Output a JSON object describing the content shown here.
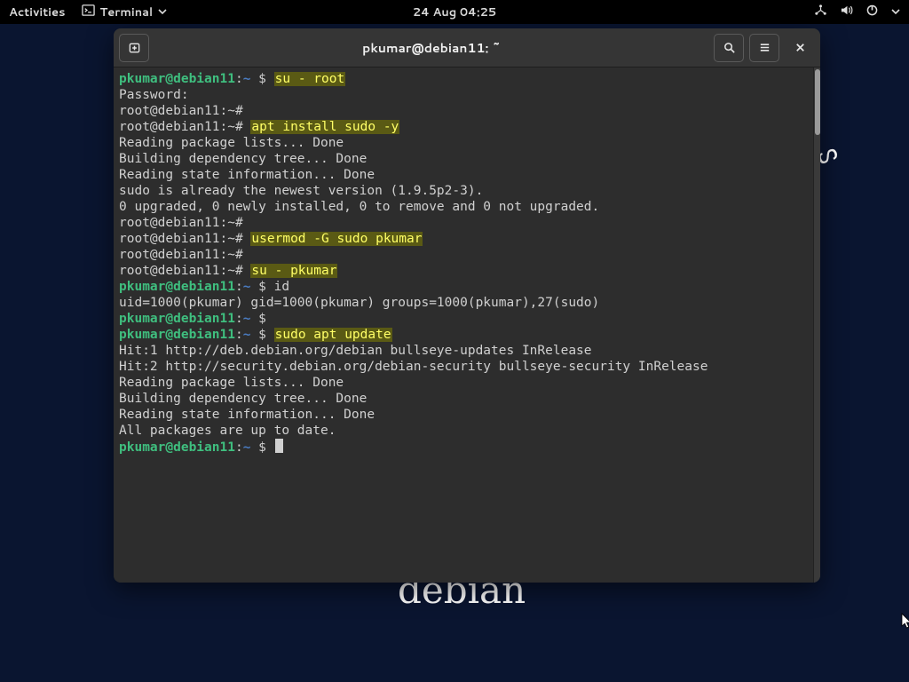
{
  "topbar": {
    "activities": "Activities",
    "app_name": "Terminal",
    "clock": "24 Aug  04:25"
  },
  "window": {
    "title": "pkumar@debian11: ~"
  },
  "prompts": {
    "user": "pkumar@debian11",
    "root": "root@debian11:~#",
    "path": "~",
    "dollar": "$"
  },
  "lines": {
    "cmd_su_root": "su - root",
    "passwd": "Password:",
    "cmd_apt_sudo": "apt install sudo -y",
    "read_pkg": "Reading package lists... Done",
    "build_dep": "Building dependency tree... Done",
    "read_state": "Reading state information... Done",
    "sudo_new": "sudo is already the newest version (1.9.5p2-3).",
    "upg_zero": "0 upgraded, 0 newly installed, 0 to remove and 0 not upgraded.",
    "cmd_usermod": "usermod -G sudo pkumar",
    "cmd_su_pkumar": "su - pkumar",
    "cmd_id": "id",
    "id_out": "uid=1000(pkumar) gid=1000(pkumar) groups=1000(pkumar),27(sudo)",
    "cmd_sudo_update": "sudo apt update",
    "hit1": "Hit:1 http://deb.debian.org/debian bullseye-updates InRelease",
    "hit2": "Hit:2 http://security.debian.org/debian-security bullseye-security InRelease",
    "all_up": "All packages are up to date."
  },
  "desktop": {
    "brand": "debian",
    "swirl": "ᔕ"
  }
}
